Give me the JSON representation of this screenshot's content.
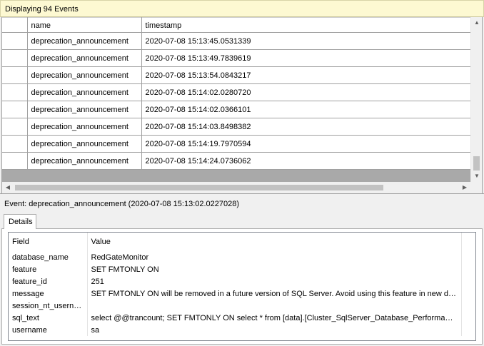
{
  "banner": {
    "text": "Displaying 94 Events"
  },
  "grid": {
    "columns": [
      "name",
      "timestamp"
    ],
    "rows": [
      {
        "name": "deprecation_announcement",
        "timestamp": "2020-07-08 15:13:45.0531339"
      },
      {
        "name": "deprecation_announcement",
        "timestamp": "2020-07-08 15:13:49.7839619"
      },
      {
        "name": "deprecation_announcement",
        "timestamp": "2020-07-08 15:13:54.0843217"
      },
      {
        "name": "deprecation_announcement",
        "timestamp": "2020-07-08 15:14:02.0280720"
      },
      {
        "name": "deprecation_announcement",
        "timestamp": "2020-07-08 15:14:02.0366101"
      },
      {
        "name": "deprecation_announcement",
        "timestamp": "2020-07-08 15:14:03.8498382"
      },
      {
        "name": "deprecation_announcement",
        "timestamp": "2020-07-08 15:14:19.7970594"
      },
      {
        "name": "deprecation_announcement",
        "timestamp": "2020-07-08 15:14:24.0736062"
      }
    ]
  },
  "event_line": {
    "text": "Event: deprecation_announcement (2020-07-08 15:13:02.0227028)"
  },
  "tabs": [
    {
      "label": "Details"
    }
  ],
  "details": {
    "columns": [
      "Field",
      "Value"
    ],
    "rows": [
      {
        "field": "database_name",
        "value": "RedGateMonitor"
      },
      {
        "field": "feature",
        "value": "SET FMTONLY ON"
      },
      {
        "field": "feature_id",
        "value": "251"
      },
      {
        "field": "message",
        "value": "SET FMTONLY ON will be removed in a future version of SQL Server. Avoid using this feature in new dev..."
      },
      {
        "field": "session_nt_username",
        "value": ""
      },
      {
        "field": "sql_text",
        "value": "select @@trancount; SET FMTONLY ON select * from [data].[Cluster_SqlServer_Database_Performance..."
      },
      {
        "field": "username",
        "value": "sa"
      }
    ]
  },
  "icons": {
    "scroll_up": "▲",
    "scroll_down": "▼",
    "scroll_left": "◀",
    "scroll_right": "▶"
  }
}
